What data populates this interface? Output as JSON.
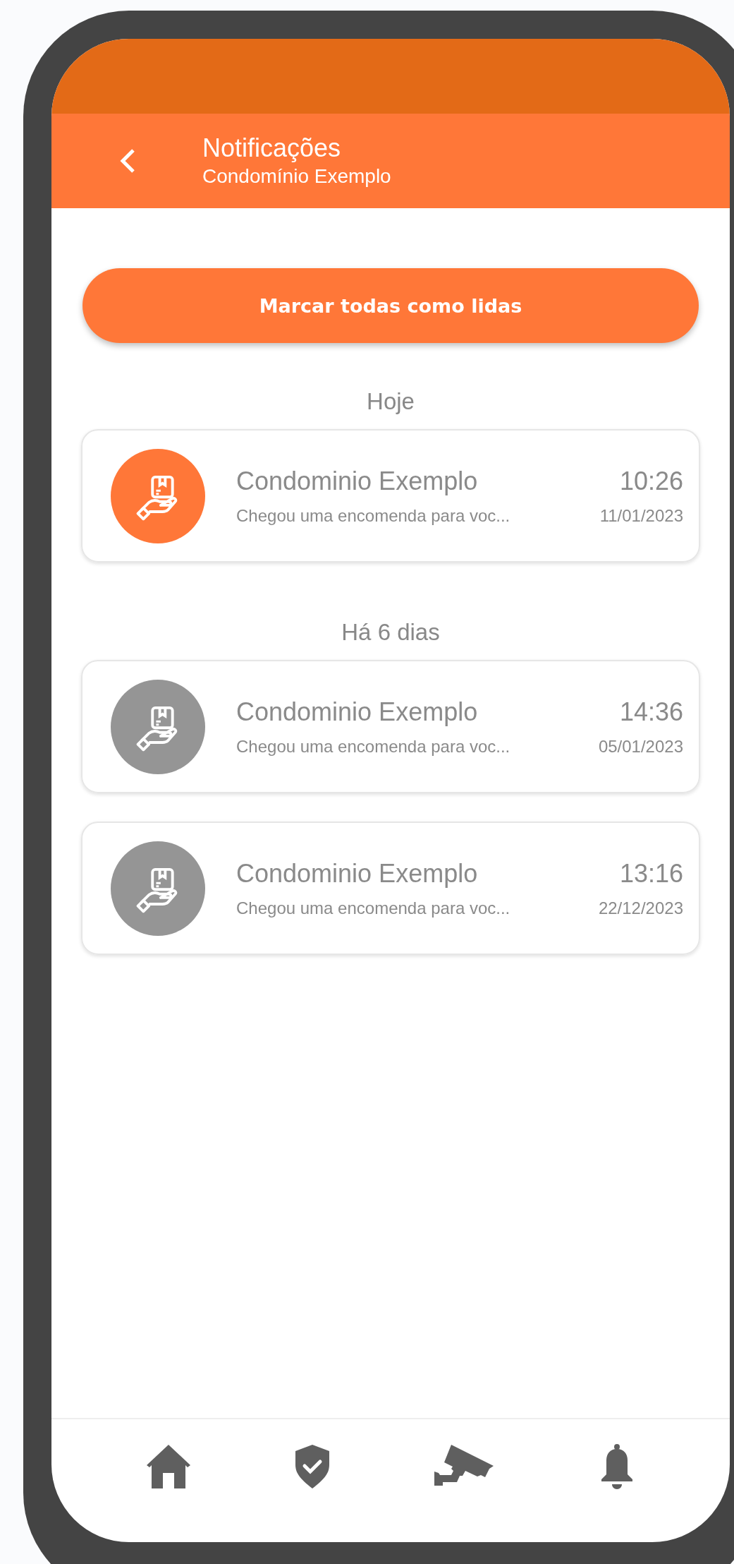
{
  "header": {
    "title": "Notificações",
    "subtitle": "Condomínio Exemplo"
  },
  "mark_all_button": "Marcar todas como lidas",
  "groups": [
    {
      "label": "Hoje",
      "notifications": [
        {
          "sender": "Condominio Exemplo",
          "message": "Chegou uma encomenda para voc...",
          "time": "10:26",
          "date": "11/01/2023",
          "unread": true
        }
      ]
    },
    {
      "label": "Há 6 dias",
      "notifications": [
        {
          "sender": "Condominio Exemplo",
          "message": "Chegou uma encomenda para voc...",
          "time": "14:36",
          "date": "05/01/2023",
          "unread": false
        },
        {
          "sender": "Condominio Exemplo",
          "message": "Chegou uma encomenda para voc...",
          "time": "13:16",
          "date": "22/12/2023",
          "unread": false
        }
      ]
    }
  ],
  "bottom_nav": [
    {
      "kind": "home"
    },
    {
      "kind": "shield"
    },
    {
      "kind": "camera"
    },
    {
      "kind": "bell"
    }
  ]
}
